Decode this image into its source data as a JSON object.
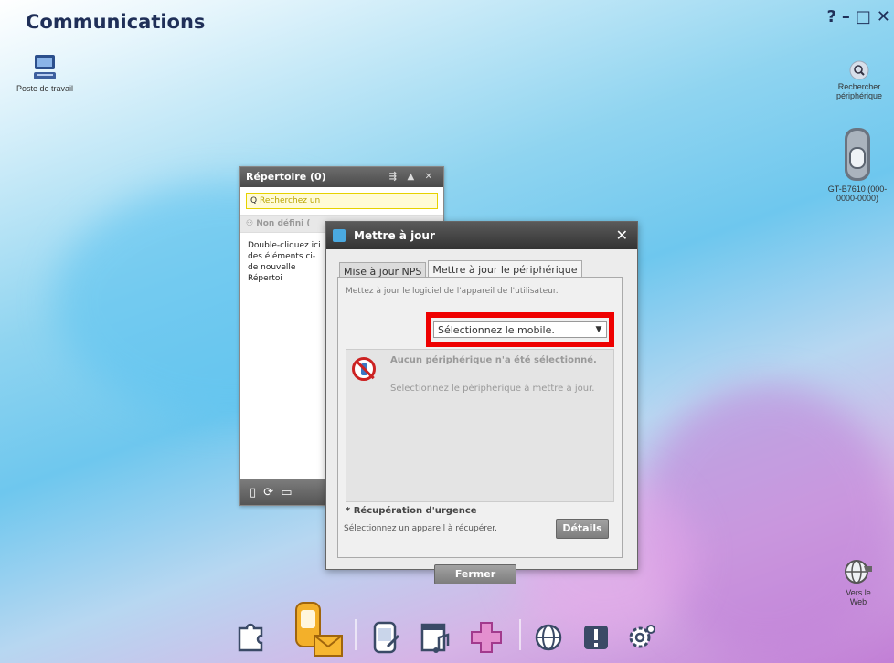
{
  "app": {
    "title": "Communications",
    "controls": [
      "?",
      "–",
      "□",
      "✕"
    ]
  },
  "desktop": {
    "poste": "Poste de travail",
    "search": "Rechercher périphérique",
    "device": "GT-B7610 (000-0000-0000)",
    "web": "Vers le Web"
  },
  "repertoire": {
    "title": "Répertoire (0)",
    "search_placeholder": "Recherchez un",
    "group": "Non défini (",
    "body": "Double-cliquez ici des éléments ci-de nouvelle Répertoi"
  },
  "dialog": {
    "title": "Mettre à jour",
    "tabs": [
      "Mise à jour NPS",
      "Mettre à jour le périphérique"
    ],
    "description": "Mettez à jour le logiciel de l'appareil de l'utilisateur.",
    "select_value": "Sélectionnez le mobile.",
    "info_title": "Aucun périphérique n'a été sélectionné.",
    "info_text": "Sélectionnez le périphérique à mettre à jour.",
    "urgence_title": "* Récupération d'urgence",
    "urgence_text": "Sélectionnez un appareil à récupérer.",
    "details_button": "Détails",
    "close_button": "Fermer"
  },
  "colors": {
    "accent": "#ee0000",
    "title": "#1f2f58"
  }
}
